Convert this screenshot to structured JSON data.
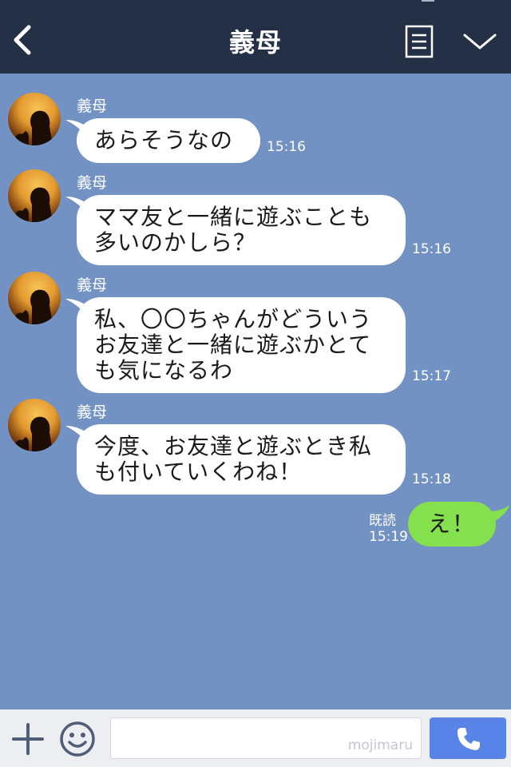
{
  "header": {
    "title": "義母"
  },
  "messages": [
    {
      "sender": "義母",
      "lines": [
        "あらそうなの"
      ],
      "time": "15:16"
    },
    {
      "sender": "義母",
      "lines": [
        "ママ友と一緒に遊ぶことも",
        "多いのかしら？"
      ],
      "time": "15:16"
    },
    {
      "sender": "義母",
      "lines": [
        "私、〇〇ちゃんがどういう",
        "お友達と一緒に遊ぶかとて",
        "も気になるわ"
      ],
      "time": "15:17"
    },
    {
      "sender": "義母",
      "lines": [
        "今度、お友達と遊ぶとき私",
        "も付いていくわね！"
      ],
      "time": "15:18"
    }
  ],
  "my_message": {
    "text": "え！",
    "read_label": "既読",
    "time": "15:19"
  },
  "footer": {
    "watermark": "mojimaru"
  },
  "colors": {
    "header_bg": "#243045",
    "chat_bg": "#7292c4",
    "my_bubble": "#85e04d",
    "call_button": "#5784e6"
  }
}
